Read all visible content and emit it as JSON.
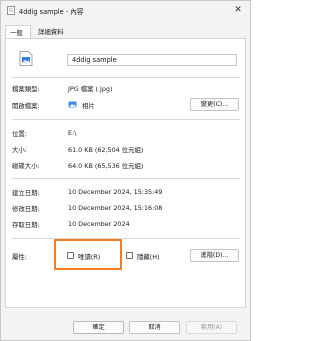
{
  "window": {
    "title": "4ddig sample - 內容",
    "close_glyph": "✕"
  },
  "tabs": [
    {
      "label": "一般"
    },
    {
      "label": "詳細資料"
    }
  ],
  "file": {
    "name": "4ddig sample"
  },
  "properties": {
    "type_label": "檔案類型:",
    "type_value": "JPG 檔案 (.jpg)",
    "opens_label": "開啟檔案:",
    "opens_value": "相片",
    "change_button": "變更(C)...",
    "location_label": "位置:",
    "location_value": "E:\\",
    "size_label": "大小:",
    "size_value": "61.0 KB (62,504 位元組)",
    "disk_label": "磁碟大小:",
    "disk_value": "64.0 KB (65,536 位元組)",
    "created_label": "建立日期:",
    "created_value": "10 December 2024, 15:35:49",
    "modified_label": "修改日期:",
    "modified_value": "10 December 2024, 15:16:08",
    "accessed_label": "存取日期:",
    "accessed_value": "10 December 2024"
  },
  "attributes": {
    "label": "屬性:",
    "readonly_label": "唯讀(R)",
    "readonly_checked": false,
    "hidden_label": "隱藏(H)",
    "hidden_checked": false,
    "advanced_button": "進階(D)..."
  },
  "footer": {
    "ok": "確定",
    "cancel": "取消",
    "apply": "套用(A)"
  },
  "colors": {
    "highlight": "#f47b20",
    "folder_blue": "#1e6fd9"
  }
}
